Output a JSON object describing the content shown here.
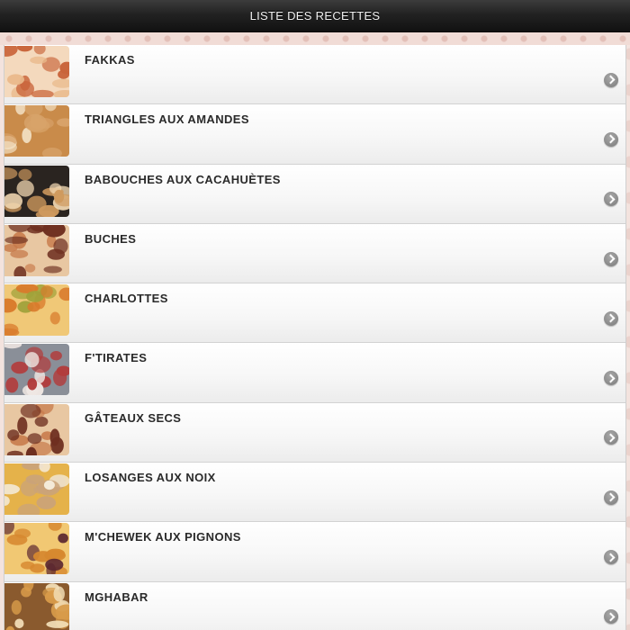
{
  "header": {
    "title": "LISTE DES RECETTES"
  },
  "recipes": [
    {
      "name": "FAKKAS",
      "image": "fakkas-photo",
      "colors": [
        "#c9643a",
        "#e9b98a",
        "#f4d9bd"
      ]
    },
    {
      "name": "TRIANGLES AUX AMANDES",
      "image": "triangles-photo",
      "colors": [
        "#d8a36a",
        "#f3e2c6",
        "#c98b4a"
      ]
    },
    {
      "name": "BABOUCHES AUX CACAHUÈTES",
      "image": "babouches-photo",
      "colors": [
        "#cf9a5e",
        "#f1d7b1",
        "#2a2420"
      ]
    },
    {
      "name": "BUCHES",
      "image": "buches-photo",
      "colors": [
        "#6e2f20",
        "#c77a4a",
        "#e8c7a2"
      ]
    },
    {
      "name": "CHARLOTTES",
      "image": "charlottes-photo",
      "colors": [
        "#d97b2c",
        "#9fa23a",
        "#f0c877"
      ]
    },
    {
      "name": "F'TIRATES",
      "image": "ftirates-photo",
      "colors": [
        "#b23b3b",
        "#efe7e2",
        "#8a8f98"
      ]
    },
    {
      "name": "GÂTEAUX SECS",
      "image": "gateaux-secs-photo",
      "colors": [
        "#6e2f20",
        "#c77a4a",
        "#e8c7a2"
      ]
    },
    {
      "name": "LOSANGES AUX NOIX",
      "image": "losanges-photo",
      "colors": [
        "#caa37a",
        "#f4ead8",
        "#e5b24a"
      ]
    },
    {
      "name": "M'CHEWEK AUX PIGNONS",
      "image": "mchewek-photo",
      "colors": [
        "#d6882f",
        "#5a2630",
        "#f1c873"
      ]
    },
    {
      "name": "MGHABAR",
      "image": "mghabar-photo",
      "colors": [
        "#d89b4a",
        "#f3dfb8",
        "#8a5a2e"
      ]
    }
  ]
}
